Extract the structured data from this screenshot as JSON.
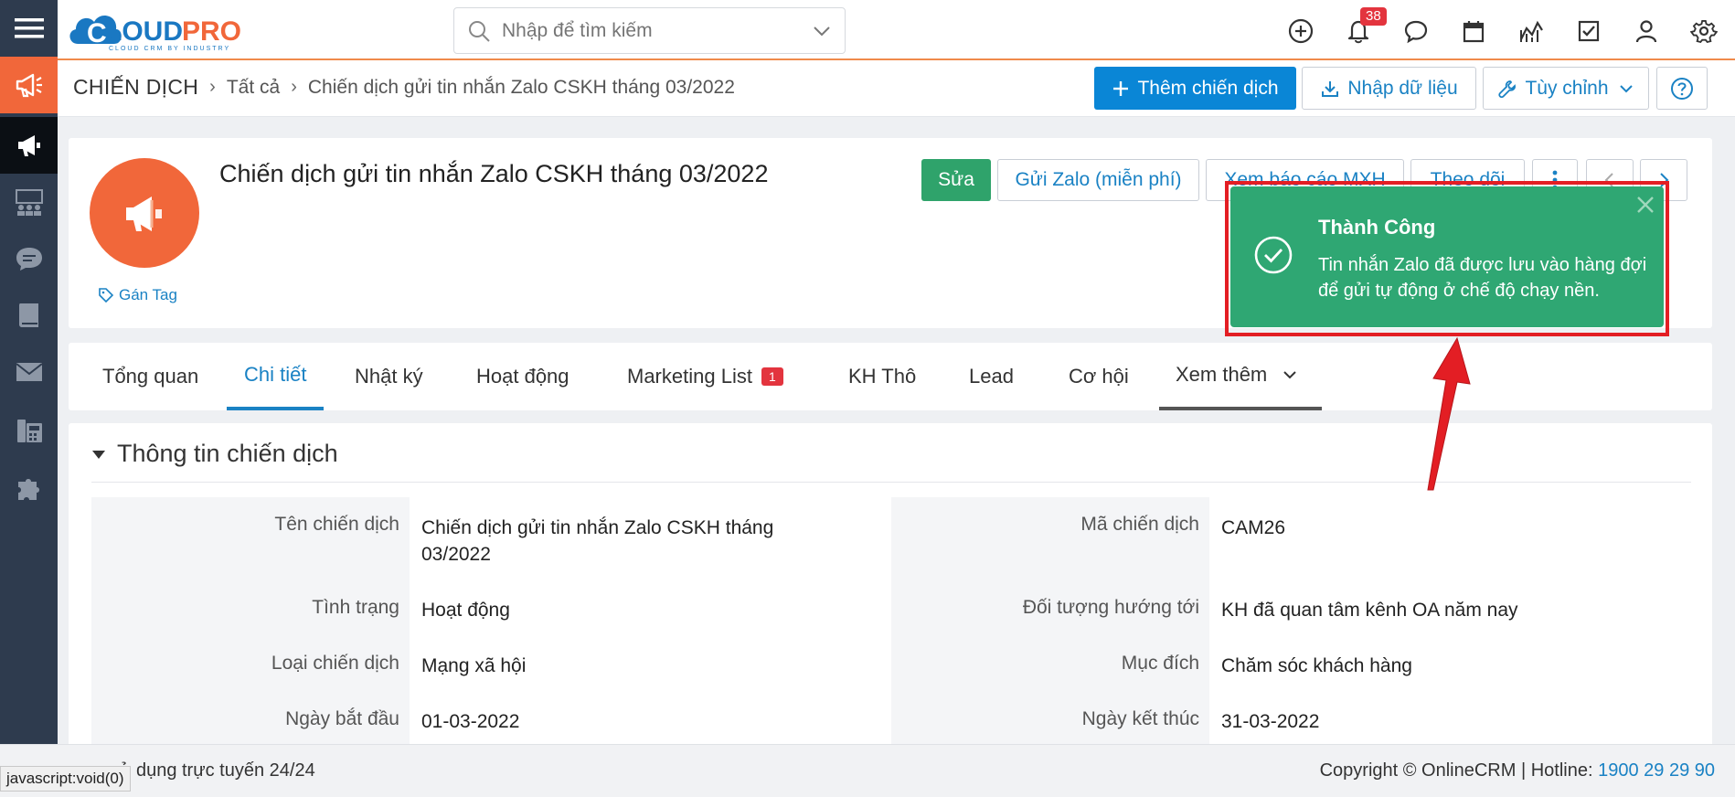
{
  "header": {
    "search_placeholder": "Nhập để tìm kiếm",
    "notification_count": "38"
  },
  "breadcrumb": {
    "module": "CHIẾN DỊCH",
    "all": "Tất cả",
    "current": "Chiến dịch gửi tin nhắn Zalo CSKH tháng 03/2022"
  },
  "toolbar": {
    "add_label": "Thêm chiến dịch",
    "import_label": "Nhập dữ liệu",
    "customize_label": "Tùy chỉnh"
  },
  "record": {
    "title": "Chiến dịch gửi tin nhắn Zalo CSKH tháng 03/2022",
    "tag_label": "Gán Tag",
    "actions": {
      "edit": "Sửa",
      "send_zalo": "Gửi Zalo (miễn phí)",
      "view_report": "Xem báo cáo MXH",
      "follow": "Theo dõi"
    }
  },
  "tabs": [
    {
      "label": "Tổng quan"
    },
    {
      "label": "Chi tiết"
    },
    {
      "label": "Nhật ký"
    },
    {
      "label": "Hoạt động"
    },
    {
      "label": "Marketing List",
      "badge": "1"
    },
    {
      "label": "KH Thô"
    },
    {
      "label": "Lead"
    },
    {
      "label": "Cơ hội"
    },
    {
      "label": "Xem thêm"
    }
  ],
  "section": {
    "title": "Thông tin chiến dịch",
    "fields_left": [
      {
        "label": "Tên chiến dịch",
        "value": "Chiến dịch gửi tin nhắn Zalo CSKH tháng 03/2022"
      },
      {
        "label": "Tình trạng",
        "value": "Hoạt động"
      },
      {
        "label": "Loại chiến dịch",
        "value": "Mạng xã hội"
      },
      {
        "label": "Ngày bắt đầu",
        "value": "01-03-2022"
      }
    ],
    "fields_right": [
      {
        "label": "Mã chiến dịch",
        "value": "CAM26"
      },
      {
        "label": "Đối tượng hướng tới",
        "value": "KH đã quan tâm kênh OA năm nay"
      },
      {
        "label": "Mục đích",
        "value": "Chăm sóc khách hàng"
      },
      {
        "label": "Ngày kết thúc",
        "value": "31-03-2022"
      }
    ]
  },
  "toast": {
    "title": "Thành Công",
    "message": "Tin nhắn Zalo đã được lưu vào hàng đợi để gửi tự động ở chế độ chạy nền."
  },
  "footer": {
    "online_text": "sử dụng trực tuyến 24/24",
    "copyright": "Copyright © OnlineCRM",
    "hotline_label": "Hotline:",
    "hotline_number": "1900 29 29 90",
    "status_url": "javascript:void(0)"
  },
  "colors": {
    "primary": "#0a86d6",
    "success": "#2fa773",
    "accent": "#f1673a",
    "sidebar": "#2e3b4e"
  }
}
